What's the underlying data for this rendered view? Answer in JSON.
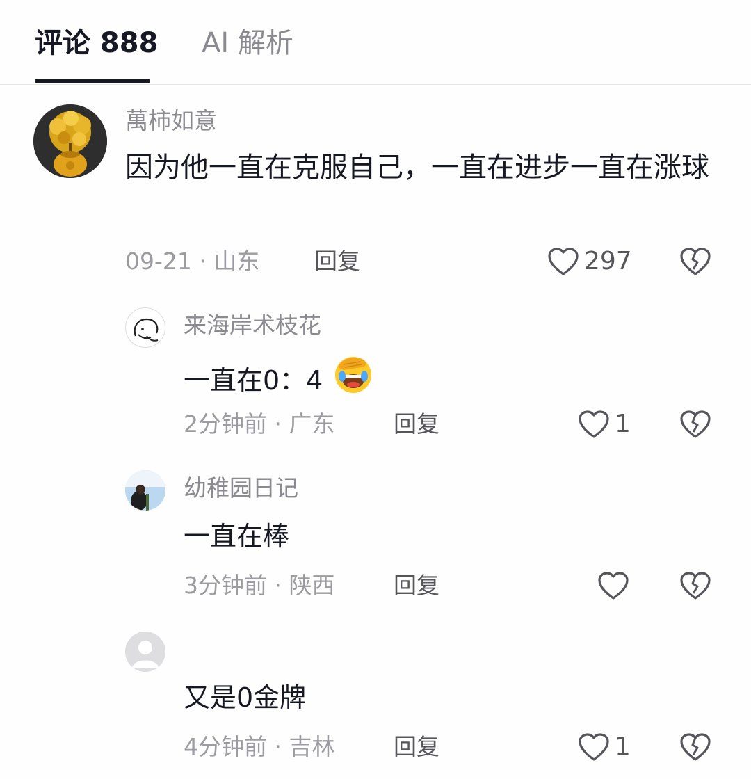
{
  "tabs": {
    "comments_label": "评论 888",
    "ai_label": "AI 解析"
  },
  "comments": [
    {
      "user": "萬柿如意",
      "text": "因为他一直在克服自己，一直在进步一直在涨球",
      "time": "09-21",
      "location": "山东",
      "reply_label": "回复",
      "likes": "297"
    },
    {
      "user": "来海岸术枝花",
      "text": "一直在0：4",
      "emoji": "facepalm-laughing-emoji",
      "time": "2分钟前",
      "location": "广东",
      "reply_label": "回复",
      "likes": "1"
    },
    {
      "user": "幼稚园日记",
      "text": "一直在棒",
      "time": "3分钟前",
      "location": "陕西",
      "reply_label": "回复",
      "likes": ""
    },
    {
      "user": "",
      "text": "又是0金牌",
      "time": "4分钟前",
      "location": "吉林",
      "reply_label": "回复",
      "likes": "1"
    }
  ],
  "colors": {
    "text": "#161823",
    "secondary": "#8a8b91",
    "divider": "#e4e4e4"
  },
  "icons": [
    "heart-outline-icon",
    "broken-heart-icon",
    "default-avatar-icon"
  ]
}
